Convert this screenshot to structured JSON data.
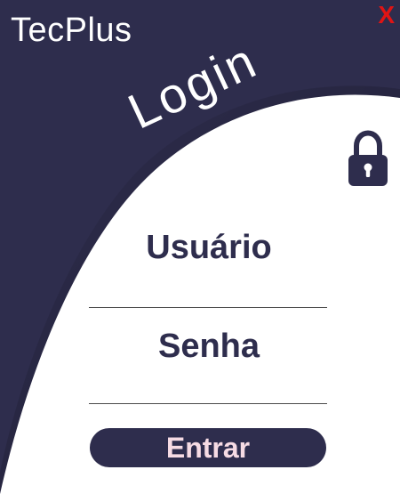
{
  "app": {
    "title": "TecPlus",
    "close_label": "X"
  },
  "login": {
    "heading": "Login",
    "username_label": "Usuário",
    "username_value": "",
    "password_label": "Senha",
    "password_value": "",
    "submit_label": "Entrar"
  },
  "icons": {
    "lock": "lock-icon"
  },
  "colors": {
    "primary": "#2e2d4d",
    "background": "#ffffff",
    "close": "#e01414",
    "button_text": "#f6dbe4"
  }
}
